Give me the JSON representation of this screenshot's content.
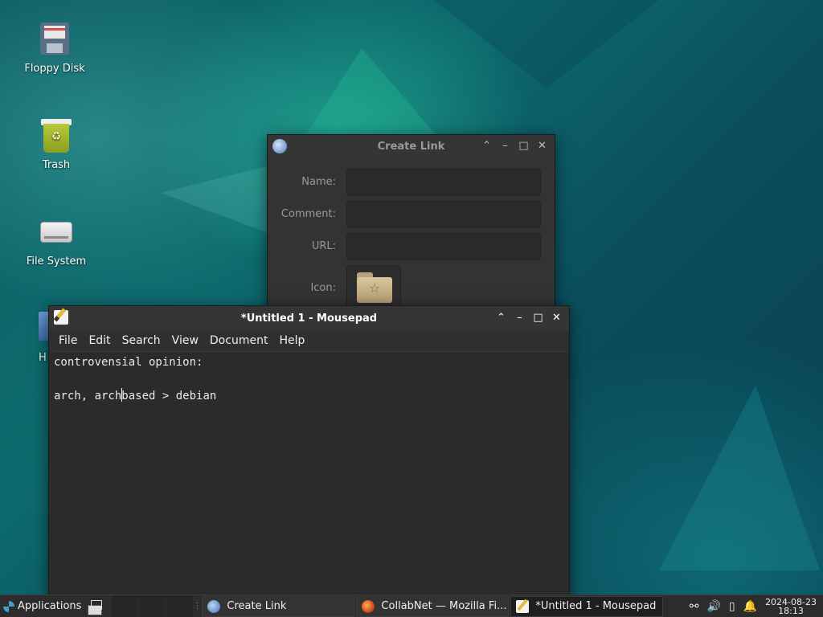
{
  "desktop": {
    "icons": [
      {
        "label": "Floppy Disk"
      },
      {
        "label": "Trash"
      },
      {
        "label": "File System"
      }
    ],
    "partial_label": "H"
  },
  "create_link": {
    "title": "Create Link",
    "fields": {
      "name_label": "Name:",
      "comment_label": "Comment:",
      "url_label": "URL:",
      "icon_label": "Icon:",
      "name_value": "",
      "comment_value": "",
      "url_value": ""
    }
  },
  "mousepad": {
    "title": "*Untitled 1 - Mousepad",
    "menu": [
      "File",
      "Edit",
      "Search",
      "View",
      "Document",
      "Help"
    ],
    "content": {
      "line1": "controvensial opinion:",
      "line2": "",
      "line3_before_caret": "arch, arch",
      "line3_after_caret": "based > debian"
    }
  },
  "taskbar": {
    "applications_label": "Applications",
    "tasks": [
      {
        "label": "Create Link",
        "icon": "link-icon",
        "active": false
      },
      {
        "label": "CollabNet — Mozilla Fi...",
        "icon": "firefox-icon",
        "active": false
      },
      {
        "label": "*Untitled 1 - Mousepad",
        "icon": "mousepad-icon",
        "active": true
      }
    ],
    "clock": {
      "date": "2024-08-23",
      "time": "18:13"
    }
  }
}
